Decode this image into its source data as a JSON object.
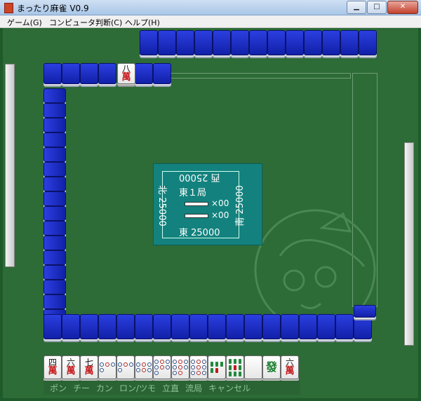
{
  "window": {
    "title": "まったり麻雀 V0.9"
  },
  "menu": [
    {
      "label": "ゲーム(G)"
    },
    {
      "label": "コンピュータ判断(C)"
    },
    {
      "label": "ヘルプ(H)"
    }
  ],
  "discard_top": {
    "num": "八",
    "suit": "萬"
  },
  "center": {
    "west_score": "西 25000",
    "round": "東１局",
    "stick1_count": "×00",
    "stick2_count": "×00",
    "east_score": "東 25000",
    "north_score": "北 25000",
    "south_score": "南 25000"
  },
  "hand": [
    {
      "kind": "man",
      "num": "四",
      "suit": "萬"
    },
    {
      "kind": "man",
      "num": "六",
      "suit": "萬"
    },
    {
      "kind": "man",
      "num": "七",
      "suit": "萬"
    },
    {
      "kind": "pin",
      "count": 4
    },
    {
      "kind": "pin",
      "count": 4
    },
    {
      "kind": "pin",
      "count": 6
    },
    {
      "kind": "pin",
      "count": 7
    },
    {
      "kind": "pin",
      "count": 8
    },
    {
      "kind": "pin",
      "count": 9
    },
    {
      "kind": "sou",
      "count": 5
    },
    {
      "kind": "sou",
      "count": 9
    },
    {
      "kind": "blank"
    },
    {
      "kind": "honor",
      "label": "發"
    },
    {
      "kind": "man",
      "num": "六",
      "suit": "萬"
    }
  ],
  "actions": [
    {
      "label": "ポン"
    },
    {
      "label": "チー"
    },
    {
      "label": "カン"
    },
    {
      "label": "ロン/ツモ"
    },
    {
      "label": "立直"
    },
    {
      "label": "流局"
    },
    {
      "label": "キャンセル"
    }
  ],
  "colors": {
    "felt": "#2d6b37",
    "tile_back": "#1a2fd0",
    "center_panel": "#13827e"
  }
}
